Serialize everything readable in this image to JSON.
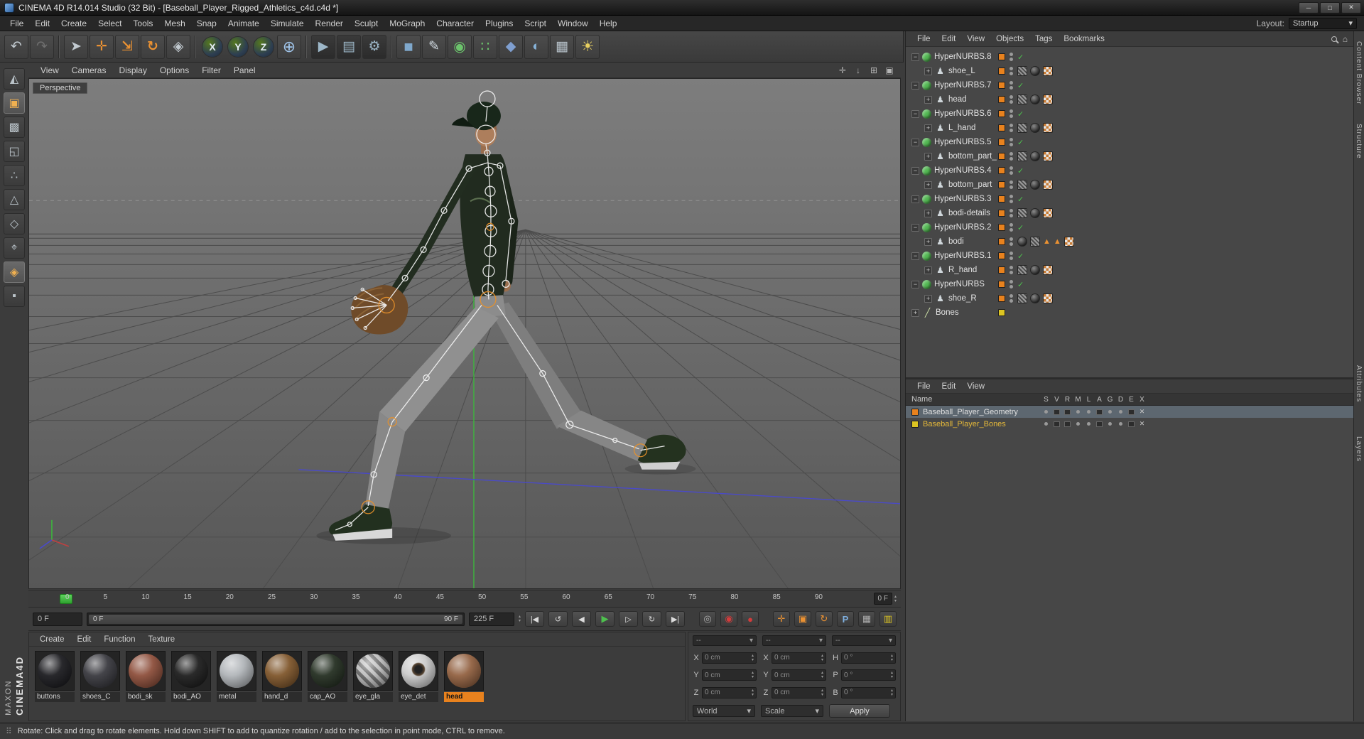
{
  "window": {
    "title": "CINEMA 4D R14.014 Studio (32 Bit) - [Baseball_Player_Rigged_Athletics_c4d.c4d *]"
  },
  "menubar": {
    "items": [
      "File",
      "Edit",
      "Create",
      "Select",
      "Tools",
      "Mesh",
      "Snap",
      "Animate",
      "Simulate",
      "Render",
      "Sculpt",
      "MoGraph",
      "Character",
      "Plugins",
      "Script",
      "Window",
      "Help"
    ],
    "layout_label": "Layout:",
    "layout_value": "Startup"
  },
  "toolbar": {
    "icons": [
      {
        "name": "undo-icon",
        "glyph": "↶"
      },
      {
        "name": "redo-icon",
        "glyph": "↷"
      },
      {
        "name": "live-selection-icon",
        "glyph": "➤"
      },
      {
        "name": "move-tool-icon",
        "glyph": "✛"
      },
      {
        "name": "scale-tool-icon",
        "glyph": "⇲"
      },
      {
        "name": "rotate-tool-icon",
        "glyph": "↻"
      },
      {
        "name": "last-tool-icon",
        "glyph": "◈"
      },
      {
        "name": "lock-x-icon",
        "glyph": "X"
      },
      {
        "name": "lock-y-icon",
        "glyph": "Y"
      },
      {
        "name": "lock-z-icon",
        "glyph": "Z"
      },
      {
        "name": "coord-system-icon",
        "glyph": "⊕"
      },
      {
        "name": "render-view-icon",
        "glyph": "▶"
      },
      {
        "name": "render-picture-viewer-icon",
        "glyph": "▤"
      },
      {
        "name": "render-settings-icon",
        "glyph": "⚙"
      },
      {
        "name": "add-cube-icon",
        "glyph": "■"
      },
      {
        "name": "spline-pen-icon",
        "glyph": "✎"
      },
      {
        "name": "subdivision-icon",
        "glyph": "◉"
      },
      {
        "name": "array-icon",
        "glyph": "∷"
      },
      {
        "name": "deformer-icon",
        "glyph": "◆"
      },
      {
        "name": "environment-icon",
        "glyph": "◐"
      },
      {
        "name": "stage-icon",
        "glyph": "▦"
      },
      {
        "name": "light-icon",
        "glyph": "☀"
      }
    ]
  },
  "left_toolbar": {
    "icons": [
      {
        "name": "make-editable-icon",
        "glyph": "◭"
      },
      {
        "name": "model-mode-icon",
        "glyph": "▣"
      },
      {
        "name": "texture-mode-icon",
        "glyph": "▩"
      },
      {
        "name": "workplane-icon",
        "glyph": "◱"
      },
      {
        "name": "points-mode-icon",
        "glyph": "∴"
      },
      {
        "name": "edges-mode-icon",
        "glyph": "△"
      },
      {
        "name": "polygons-mode-icon",
        "glyph": "◇"
      },
      {
        "name": "axis-mode-icon",
        "glyph": "⌖"
      },
      {
        "name": "snap-icon",
        "glyph": "◈"
      },
      {
        "name": "lock-workplane-icon",
        "glyph": "▪"
      }
    ]
  },
  "viewport": {
    "menus": [
      "View",
      "Cameras",
      "Display",
      "Options",
      "Filter",
      "Panel"
    ],
    "camera_label": "Perspective",
    "corner_icons": [
      {
        "name": "pan-view-icon",
        "glyph": "✛"
      },
      {
        "name": "scroll-view-icon",
        "glyph": "↓"
      },
      {
        "name": "swap-view-icon",
        "glyph": "⊞"
      },
      {
        "name": "maximize-view-icon",
        "glyph": "▣"
      }
    ]
  },
  "object_manager": {
    "menus": [
      "File",
      "Edit",
      "View",
      "Objects",
      "Tags",
      "Bookmarks"
    ],
    "rows": [
      {
        "label": "HyperNURBS.8"
      },
      {
        "label": "shoe_L"
      },
      {
        "label": "HyperNURBS.7"
      },
      {
        "label": "head"
      },
      {
        "label": "HyperNURBS.6"
      },
      {
        "label": "L_hand"
      },
      {
        "label": "HyperNURBS.5"
      },
      {
        "label": "bottom_part_"
      },
      {
        "label": "HyperNURBS.4"
      },
      {
        "label": "bottom_part"
      },
      {
        "label": "HyperNURBS.3"
      },
      {
        "label": "bodi-details"
      },
      {
        "label": "HyperNURBS.2"
      },
      {
        "label": "bodi"
      },
      {
        "label": "HyperNURBS.1"
      },
      {
        "label": "R_hand"
      },
      {
        "label": "HyperNURBS"
      },
      {
        "label": "shoe_R"
      },
      {
        "label": "Bones"
      }
    ]
  },
  "layer_manager": {
    "menus": [
      "File",
      "Edit",
      "View"
    ],
    "name_header": "Name",
    "columns": [
      "S",
      "V",
      "R",
      "M",
      "L",
      "A",
      "G",
      "D",
      "E",
      "X"
    ],
    "rows": [
      {
        "label": "Baseball_Player_Geometry",
        "color": "#e8821e"
      },
      {
        "label": "Baseball_Player_Bones",
        "color": "#ddc522"
      }
    ]
  },
  "timeline": {
    "ticks": [
      "0",
      "5",
      "10",
      "15",
      "20",
      "25",
      "30",
      "35",
      "40",
      "45",
      "50",
      "55",
      "60",
      "65",
      "70",
      "75",
      "80",
      "85",
      "90"
    ],
    "end_spinner": "0 F"
  },
  "transport": {
    "current": "0 F",
    "range_start": "0 F",
    "range_end": "90 F",
    "total": "225 F",
    "buttons": [
      {
        "name": "goto-start-button",
        "glyph": "|◀"
      },
      {
        "name": "prev-key-button",
        "glyph": "↺"
      },
      {
        "name": "prev-frame-button",
        "glyph": "◀"
      },
      {
        "name": "play-button",
        "glyph": "▶"
      },
      {
        "name": "next-frame-button",
        "glyph": "▷"
      },
      {
        "name": "next-key-button",
        "glyph": "↻"
      },
      {
        "name": "goto-end-button",
        "glyph": "▶|"
      }
    ],
    "record_buttons": [
      {
        "name": "solo-ring-icon",
        "glyph": "◎"
      },
      {
        "name": "record-objects-icon",
        "glyph": "◉"
      },
      {
        "name": "autokey-icon",
        "glyph": "●"
      }
    ],
    "key_buttons": [
      {
        "name": "record-position-icon",
        "glyph": "✛"
      },
      {
        "name": "record-scale-icon",
        "glyph": "▣"
      },
      {
        "name": "record-rotation-icon",
        "glyph": "↻"
      },
      {
        "name": "record-parameter-icon",
        "glyph": "P"
      },
      {
        "name": "record-point-icon",
        "glyph": "▦"
      },
      {
        "name": "keyframe-selection-icon",
        "glyph": "▥"
      }
    ]
  },
  "materials": {
    "menus": [
      "Create",
      "Edit",
      "Function",
      "Texture"
    ],
    "items": [
      {
        "label": "buttons",
        "color": "#16161a"
      },
      {
        "label": "shoes_C",
        "color": "#34343a"
      },
      {
        "label": "bodi_sk",
        "color": "#8a4a36"
      },
      {
        "label": "bodi_AO",
        "color": "#181818"
      },
      {
        "label": "metal",
        "color": "#aeb2b6"
      },
      {
        "label": "hand_d",
        "color": "#7c5226"
      },
      {
        "label": "cap_AO",
        "color": "#1f2a1c"
      },
      {
        "label": "eye_gla",
        "color": "#8f9499"
      },
      {
        "label": "eye_det",
        "color": "#c9c9c9"
      },
      {
        "label": "head",
        "color": "#8f5d3c"
      }
    ]
  },
  "coordinates": {
    "headers": [
      "--",
      "--",
      "--"
    ],
    "rows": [
      {
        "pos_label": "X",
        "pos_value": "0 cm",
        "size_label": "X",
        "size_value": "0 cm",
        "rot_label": "H",
        "rot_value": "0 °"
      },
      {
        "pos_label": "Y",
        "pos_value": "0 cm",
        "size_label": "Y",
        "size_value": "0 cm",
        "rot_label": "P",
        "rot_value": "0 °"
      },
      {
        "pos_label": "Z",
        "pos_value": "0 cm",
        "size_label": "Z",
        "size_value": "0 cm",
        "rot_label": "B",
        "rot_value": "0 °"
      }
    ],
    "world": "World",
    "scale_mode": "Scale",
    "apply": "Apply"
  },
  "status": {
    "text": "Rotate: Click and drag to rotate elements. Hold down SHIFT to add to quantize rotation / add to the selection in point mode, CTRL to remove."
  },
  "side_tabs": [
    "Content Browser",
    "Structure",
    "Attributes",
    "Layers"
  ],
  "branding": {
    "line1": "CINEMA4D",
    "line2": "MAXON"
  },
  "colors": {
    "accent_orange": "#e8821e",
    "accent_yellow": "#ddc522",
    "check_green": "#4ec04e",
    "hypernurbs_green": "#53b953"
  },
  "icons": {
    "dropdown": "▾",
    "spin_up": "▴",
    "spin_down": "▾",
    "check": "✓",
    "minus": "−",
    "plus": "+",
    "warning": "▲",
    "min": "─",
    "max": "□",
    "close": "✕",
    "grip": "⠿",
    "home": "⌂",
    "mesh": "♟",
    "bone": "╱"
  }
}
